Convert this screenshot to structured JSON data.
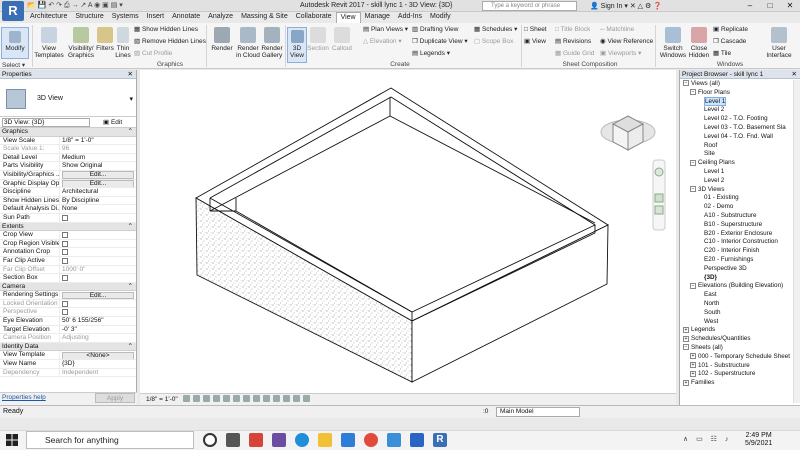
{
  "app": {
    "logo_letter": "R",
    "title": "Autodesk Revit 2017 -    skill lync 1 - 3D View: {3D}"
  },
  "header": {
    "search_placeholder": "Type a keyword or phrase",
    "user": "Sign In",
    "window_controls": [
      "–",
      "□",
      "✕"
    ]
  },
  "tabs": [
    "Architecture",
    "Structure",
    "Systems",
    "Insert",
    "Annotate",
    "Analyze",
    "Massing & Site",
    "Collaborate",
    "View",
    "Manage",
    "Add-Ins",
    "Modify"
  ],
  "active_tab": "View",
  "ribbon": {
    "modify": "Modify",
    "select": "Select ▾",
    "view_templates": "View\nTemplates",
    "visibility_graphics": "Visibility/\nGraphics",
    "filters": "Filters",
    "thin_lines": "Thin\nLines",
    "show_hidden": "Show Hidden Lines",
    "remove_hidden": "Remove Hidden Lines",
    "cut_profile": "Cut Profile",
    "graphics_label": "Graphics",
    "render": "Render",
    "render_cloud": "Render\nin Cloud",
    "render_gallery": "Render\nGallery",
    "view_3d": "3D\nView",
    "section": "Section",
    "callout": "Callout",
    "plan_views": "Plan Views ▾",
    "elevation": "Elevation ▾",
    "drafting_view": "Drafting View",
    "duplicate_view": "Duplicate View ▾",
    "legends": "Legends ▾",
    "schedules": "Schedules ▾",
    "scope_box": "Scope Box",
    "create_label": "Create",
    "sheet": "Sheet",
    "view": "View",
    "title_block": "Title Block",
    "revisions": "Revisions",
    "guide_grid": "Guide Grid",
    "matchline": "Matchline",
    "view_reference": "View Reference",
    "viewports": "Viewports ▾",
    "sheet_comp_label": "Sheet Composition",
    "switch_windows": "Switch\nWindows",
    "close_hidden": "Close\nHidden",
    "replicate": "Replicate",
    "cascade": "Cascade",
    "tile": "Tile",
    "user_interface": "User\nInterface",
    "windows_label": "Windows"
  },
  "properties": {
    "title": "Properties",
    "type_name": "3D View",
    "instance": "3D View: {3D}",
    "edit_type": "Edit Type",
    "help": "Properties help",
    "apply": "Apply",
    "groups": [
      {
        "name": "Graphics",
        "rows": [
          [
            "View Scale",
            "1/8\" = 1'-0\"",
            "n"
          ],
          [
            "Scale Value    1:",
            "96",
            "d"
          ],
          [
            "Detail Level",
            "Medium",
            "n"
          ],
          [
            "Parts Visibility",
            "Show Original",
            "n"
          ],
          [
            "Visibility/Graphics ...",
            "Edit...",
            "b"
          ],
          [
            "Graphic Display Op...",
            "Edit...",
            "b"
          ],
          [
            "Discipline",
            "Architectural",
            "n"
          ],
          [
            "Show Hidden Lines",
            "By Discipline",
            "n"
          ],
          [
            "Default Analysis Di...",
            "None",
            "n"
          ],
          [
            "Sun Path",
            "",
            "c"
          ]
        ]
      },
      {
        "name": "Extents",
        "rows": [
          [
            "Crop View",
            "",
            "c"
          ],
          [
            "Crop Region Visible",
            "",
            "c"
          ],
          [
            "Annotation Crop",
            "",
            "c"
          ],
          [
            "Far Clip Active",
            "",
            "c"
          ],
          [
            "Far Clip Offset",
            "1000'  0\"",
            "d"
          ],
          [
            "Section Box",
            "",
            "c"
          ]
        ]
      },
      {
        "name": "Camera",
        "rows": [
          [
            "Rendering Settings",
            "Edit...",
            "b"
          ],
          [
            "Locked Orientation",
            "",
            "dc"
          ],
          [
            "Perspective",
            "",
            "dc"
          ],
          [
            "Eye Elevation",
            "50'  6 155/256\"",
            "n"
          ],
          [
            "Target Elevation",
            "-0'  3\"",
            "n"
          ],
          [
            "Camera Position",
            "Adjusting",
            "d"
          ]
        ]
      },
      {
        "name": "Identity Data",
        "rows": [
          [
            "View Template",
            "<None>",
            "b"
          ],
          [
            "View Name",
            "{3D}",
            "n"
          ],
          [
            "Dependency",
            "Independent",
            "d"
          ]
        ]
      }
    ]
  },
  "browser": {
    "title": "Project Browser - skill lync 1",
    "nodes": [
      {
        "label": "Views (all)",
        "lvl": 0,
        "ex": "−"
      },
      {
        "label": "Floor Plans",
        "lvl": 1,
        "ex": "−"
      },
      {
        "label": "Level 1",
        "lvl": 3,
        "sel": true
      },
      {
        "label": "Level 2",
        "lvl": 3
      },
      {
        "label": "Level 02 - T.O. Footing",
        "lvl": 3
      },
      {
        "label": "Level 03 - T.O. Basement Sla",
        "lvl": 3
      },
      {
        "label": "Level 04 - T.O. Fnd. Wall",
        "lvl": 3
      },
      {
        "label": "Roof",
        "lvl": 3
      },
      {
        "label": "Site",
        "lvl": 3
      },
      {
        "label": "Ceiling Plans",
        "lvl": 1,
        "ex": "−"
      },
      {
        "label": "Level 1",
        "lvl": 3
      },
      {
        "label": "Level 2",
        "lvl": 3
      },
      {
        "label": "3D Views",
        "lvl": 1,
        "ex": "−"
      },
      {
        "label": "01 - Existing",
        "lvl": 3
      },
      {
        "label": "02 - Demo",
        "lvl": 3
      },
      {
        "label": "A10 - Substructure",
        "lvl": 3
      },
      {
        "label": "B10 - Superstructure",
        "lvl": 3
      },
      {
        "label": "B20 - Exterior Enclosure",
        "lvl": 3
      },
      {
        "label": "C10 - Interior Construction",
        "lvl": 3
      },
      {
        "label": "C20 - Interior Finish",
        "lvl": 3
      },
      {
        "label": "E20 - Furnishings",
        "lvl": 3
      },
      {
        "label": "Perspective 3D",
        "lvl": 3
      },
      {
        "label": "{3D}",
        "lvl": 3,
        "bold": true
      },
      {
        "label": "Elevations (Building Elevation)",
        "lvl": 1,
        "ex": "−"
      },
      {
        "label": "East",
        "lvl": 3
      },
      {
        "label": "North",
        "lvl": 3
      },
      {
        "label": "South",
        "lvl": 3
      },
      {
        "label": "West",
        "lvl": 3
      },
      {
        "label": "Legends",
        "lvl": 0,
        "ex": "+"
      },
      {
        "label": "Schedules/Quantities",
        "lvl": 0,
        "ex": "+"
      },
      {
        "label": "Sheets (all)",
        "lvl": 0,
        "ex": "−"
      },
      {
        "label": "000 - Temporary Schedule Sheet",
        "lvl": 1,
        "ex": "+"
      },
      {
        "label": "101 - Substructure",
        "lvl": 1,
        "ex": "+"
      },
      {
        "label": "102 - Superstructure",
        "lvl": 1,
        "ex": "+"
      },
      {
        "label": "Families",
        "lvl": 0,
        "ex": "+"
      }
    ]
  },
  "viewbar": {
    "scale": "1/8\" = 1'-0\""
  },
  "status": {
    "text": "Ready",
    "zero": ":0",
    "model": "Main Model"
  },
  "taskbar": {
    "search": "Search for anything",
    "time": "2:49 PM",
    "date": "5/9/2021"
  },
  "colors": {
    "accent": "#3b6fb5",
    "selection": "#cfe3fb",
    "ribbon_bg": "#f5f5f5"
  }
}
